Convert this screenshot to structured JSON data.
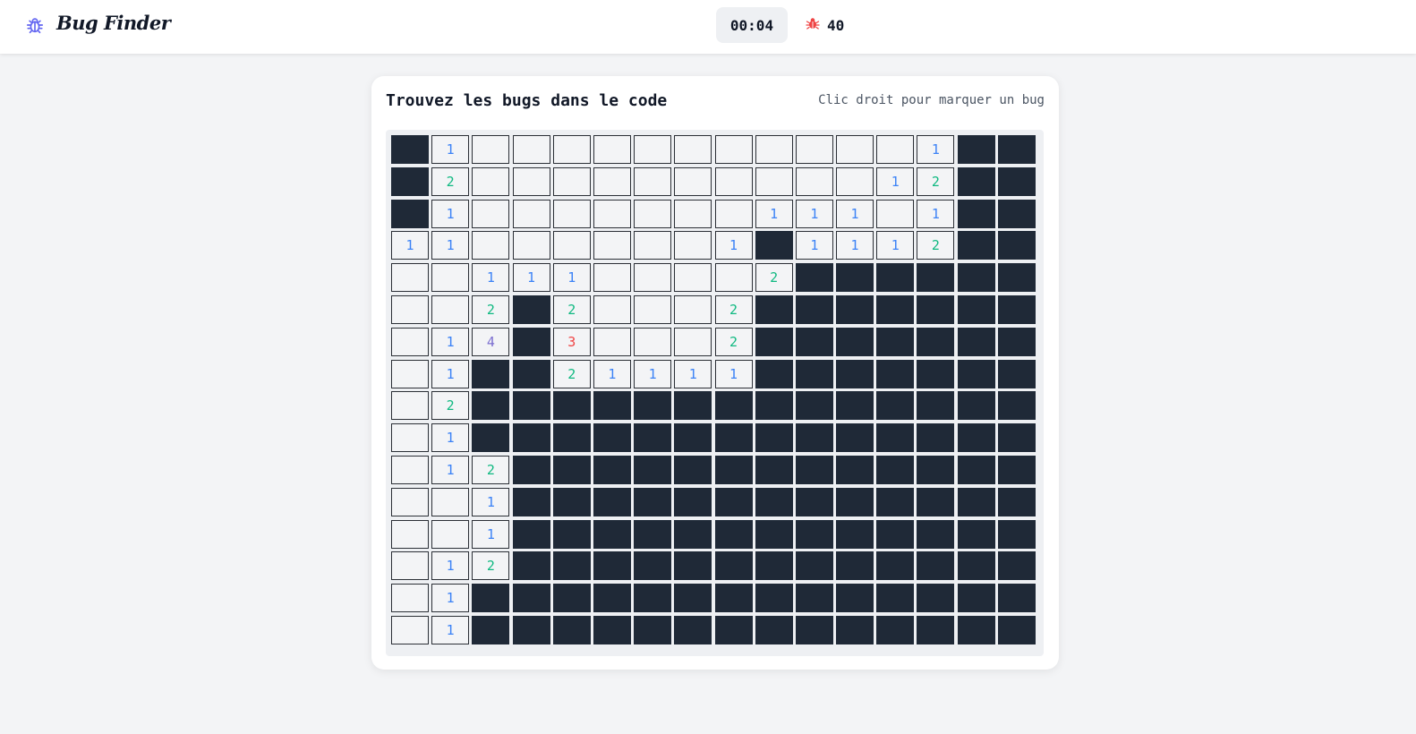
{
  "header": {
    "app_title": "Bug Finder",
    "logo_icon": "bug-icon",
    "timer": "00:04",
    "bug_count": "40",
    "bug_count_icon": "bug-icon"
  },
  "colors": {
    "accent": "#6366f1",
    "hidden_cell": "#1f2937",
    "open_cell": "#f3f4f6",
    "number_1": "#3b82f6",
    "number_2": "#10b981",
    "number_3": "#ef4444",
    "number_4": "#7c6fd0",
    "bug_icon": "#ef4444"
  },
  "game": {
    "title": "Trouvez les bugs dans le code",
    "hint": "Clic droit pour marquer un bug",
    "rows": 16,
    "cols": 16,
    "legend": {
      "#": "hidden",
      "0": "revealed-empty",
      "1-8": "revealed-number"
    },
    "board": [
      "#1000000000001###",
      "#2000000000012##",
      "#1000000011101##",
      "110000001#1112##",
      "0011100002#######",
      "002#20002#######",
      "014#30002#######",
      "01##21111#######",
      "02##############",
      "01##############",
      "012#############",
      "001#############",
      "001#############",
      "012#############",
      "01##############",
      "01##############"
    ]
  }
}
